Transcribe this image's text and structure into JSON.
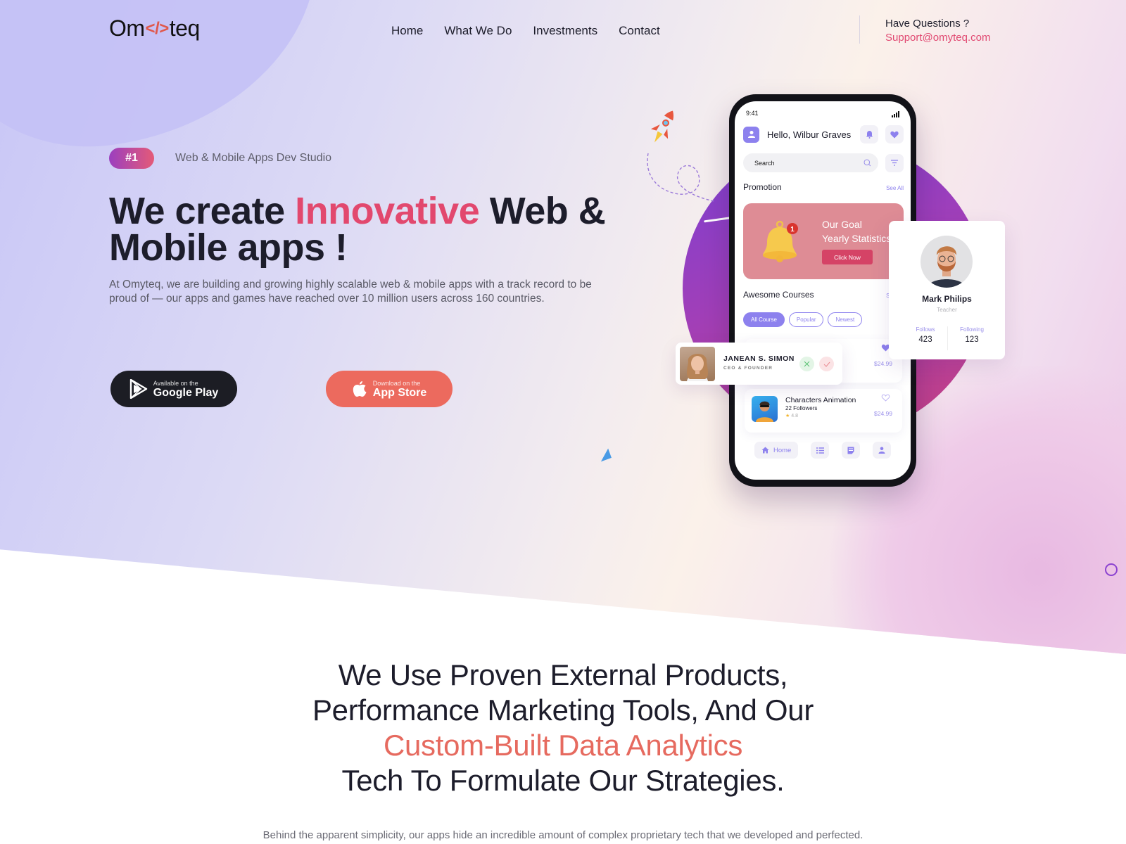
{
  "header": {
    "logo_left": "Om",
    "logo_code": "</>",
    "logo_right": "teq",
    "nav": [
      {
        "label": "Home"
      },
      {
        "label": "What We Do"
      },
      {
        "label": "Investments"
      },
      {
        "label": "Contact"
      }
    ],
    "contact_question": "Have Questions ?",
    "contact_email": "Support@omyteq.com"
  },
  "hero": {
    "badge": "#1",
    "badge_text": "Web & Mobile Apps Dev Studio",
    "title_part1": "We create ",
    "title_accent": "Innovative",
    "title_part2": " Web & Mobile apps !",
    "description": "At Omyteq, we are building and growing highly scalable web & mobile apps with a track record to be proud of — our apps and games have reached over 10 million users across 160 countries.",
    "google_play": {
      "small": "Available on the",
      "big": "Google Play",
      "icon": "google-play-icon"
    },
    "app_store": {
      "small": "Download on the",
      "big": "App Store",
      "icon": "apple-icon"
    }
  },
  "phone": {
    "time": "9:41",
    "greeting": "Hello, Wilbur Graves",
    "search_placeholder": "Search",
    "promotion_title": "Promotion",
    "promotion_link": "See All",
    "promo_line1": "Our Goal",
    "promo_line2": "Yearly Statistics",
    "promo_button": "Click Now",
    "promo_badge": "1",
    "courses_title": "Awesome Courses",
    "courses_link": "See All",
    "chips": [
      {
        "label": "All Course",
        "active": true
      },
      {
        "label": "Popular",
        "active": false
      },
      {
        "label": "Newest",
        "active": false
      }
    ],
    "courses": [
      {
        "title": "",
        "followers": "",
        "rating": "",
        "price": "$24.99",
        "favorite": true
      },
      {
        "title": "Characters Animation",
        "followers": "22 Followers",
        "rating": "4.8",
        "price": "$24.99",
        "favorite": false
      }
    ],
    "bottom_nav": [
      {
        "label": "Home",
        "icon": "home-icon"
      },
      {
        "label": "",
        "icon": "list-icon"
      },
      {
        "label": "",
        "icon": "notes-icon"
      },
      {
        "label": "",
        "icon": "user-icon"
      }
    ]
  },
  "profile_card": {
    "name": "Mark Philips",
    "role": "Teacher",
    "follows_label": "Follows",
    "follows_value": "423",
    "following_label": "Following",
    "following_value": "123"
  },
  "person_card": {
    "name": "JANEAN S. SIMON",
    "role": "CEO & FOUNDER"
  },
  "section": {
    "title_line1": "We Use Proven External Products,",
    "title_line2": "Performance Marketing Tools, And Our",
    "title_accent": "Custom-Built Data Analytics",
    "title_line4": "Tech To Formulate Our Strategies.",
    "description": "Behind the apparent simplicity, our apps hide an incredible amount of complex proprietary tech that we developed and perfected."
  },
  "colors": {
    "accent_pink": "#e2486e",
    "accent_coral": "#e66a5f",
    "app_purple": "#8d81ee",
    "dark": "#1d1d2b"
  }
}
